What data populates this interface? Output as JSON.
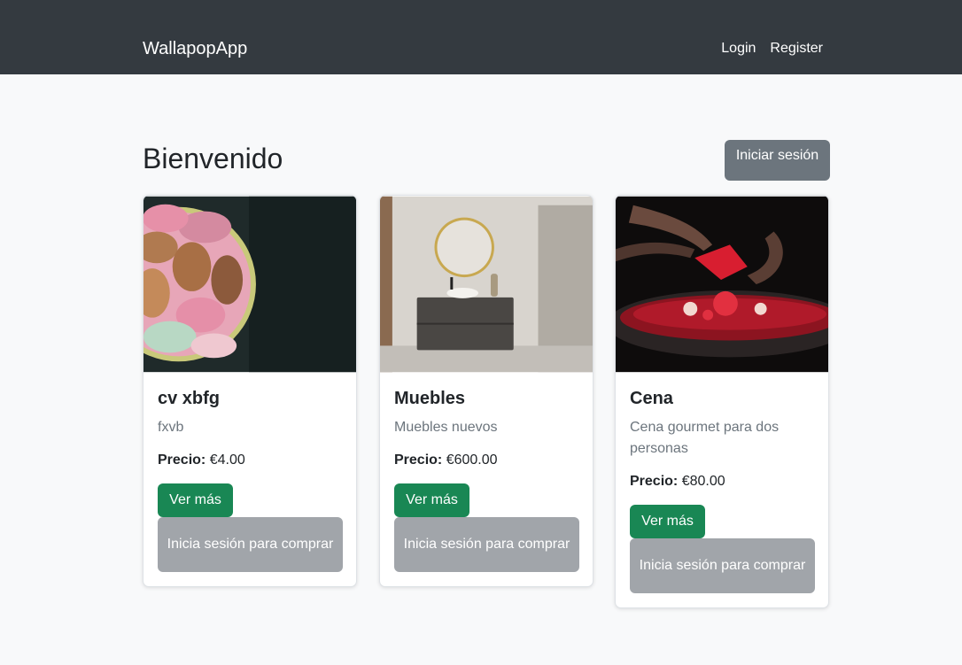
{
  "navbar": {
    "brand": "WallapopApp",
    "links": [
      "Login",
      "Register"
    ]
  },
  "page": {
    "title": "Bienvenido",
    "login_button": "Iniciar sesión"
  },
  "products": [
    {
      "title": "cv xbfg",
      "description": "fxvb",
      "price_label": "Precio:",
      "price": "€4.00",
      "more_button": "Ver más",
      "buy_button": "Inicia sesión para comprar",
      "image": "macarons-photo"
    },
    {
      "title": "Muebles",
      "description": "Muebles nuevos",
      "price_label": "Precio:",
      "price": "€600.00",
      "more_button": "Ver más",
      "buy_button": "Inicia sesión para comprar",
      "image": "bathroom-vanity-photo"
    },
    {
      "title": "Cena",
      "description": "Cena gourmet para dos personas",
      "price_label": "Precio:",
      "price": "€80.00",
      "more_button": "Ver más",
      "buy_button": "Inicia sesión para comprar",
      "image": "gourmet-dish-photo"
    }
  ],
  "colors": {
    "navbar": "#343a40",
    "page_bg": "#f8f9fa",
    "success": "#198754",
    "secondary": "#6c757d",
    "disabled": "#a1a5aa"
  }
}
